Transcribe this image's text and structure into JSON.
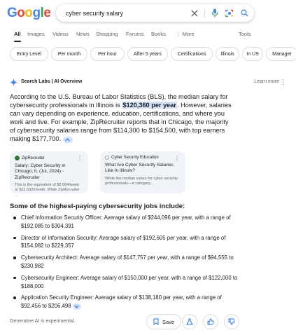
{
  "header": {
    "logo_text": "Google",
    "search_query": "cyber security salary"
  },
  "tabs": [
    {
      "label": "All",
      "active": true
    },
    {
      "label": "Images"
    },
    {
      "label": "Videos"
    },
    {
      "label": "News"
    },
    {
      "label": "Shopping"
    },
    {
      "label": "Forums"
    },
    {
      "label": "Books"
    },
    {
      "label": "More"
    },
    {
      "label": "Tools"
    }
  ],
  "chips": [
    "Entry Level",
    "Per month",
    "Per hour",
    "After 5 years",
    "Certifications",
    "Illinois",
    "In US",
    "Manager"
  ],
  "ai_overview": {
    "title": "Search Labs | AI Overview",
    "learn_more": "Learn more",
    "text_1": "According to the U.S. Bureau of Labor Statistics (BLS), the median salary for cybersecurity professionals in Illinois is ",
    "highlight": "$120,360 per year",
    "text_2": ". However, salaries can vary depending on experience, education, certifications, and where you work and live. For example, ZipRecruiter reports that in Chicago, the majority of cybersecurity salaries range from $114,300 to $154,500, with top earners making $177,700."
  },
  "sources": [
    {
      "site": "ZipRecruiter",
      "title": "Salary: Cyber Security in Chicago, IL (Jul, 2024) - ZipRecruiter",
      "snippet": "This is the equivalent of $2,684/week or $11,632/month. While ZipRecruiter ..."
    },
    {
      "site": "Cyber Security Education",
      "title": "What Are Cyber Security Salaries Like in Illinois?",
      "snippet": "While the median salary for cyber security professionals—a category..."
    }
  ],
  "jobs": {
    "heading": "Some of the highest-paying cybersecurity jobs include:",
    "items": [
      "Chief Information Security Officer: Average salary of $244,096 per year, with a range of $192,085 to $304,391",
      "Director of Information Security: Average salary of $192,605 per year, with a range of $154,082 to $229,357",
      "Cybersecurity Architect: Average salary of $147,757 per year, with a range of $94,555 to $230,982",
      "Cybersecurity Engineer: Average salary of $150,000 per year, with a range of $122,000 to $188,000",
      "Application Security Engineer: Average salary of $138,180 per year, with a range of $92,456 to $206,498"
    ]
  },
  "footer": {
    "note": "Generative AI is experimental.",
    "save_label": "Save"
  },
  "colors": {
    "accent": "#1a73e8",
    "highlight_bg": "#d3e3fd",
    "card_bg": "#f0f4f9"
  }
}
